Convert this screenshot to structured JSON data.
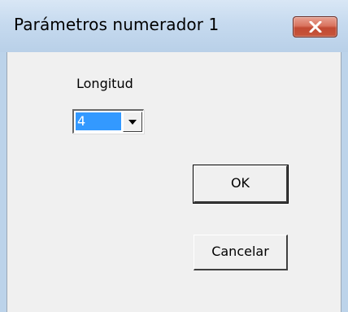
{
  "window": {
    "title": "Parámetros numerador 1",
    "close_icon": "close-icon",
    "close_color": "#c24a33"
  },
  "form": {
    "length_label": "Longitud",
    "length_value": "4",
    "dropdown_icon": "chevron-down-icon"
  },
  "buttons": {
    "ok_label": "OK",
    "cancel_label": "Cancelar"
  }
}
